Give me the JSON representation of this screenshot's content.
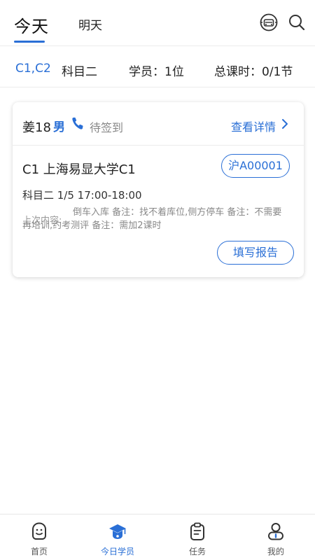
{
  "header": {
    "tabs": [
      {
        "label": "今天",
        "active": true
      },
      {
        "label": "明天",
        "active": false
      }
    ],
    "icons": [
      "car-icon",
      "search-icon"
    ]
  },
  "summary": {
    "license": "C1,C2",
    "subject": "科目二",
    "students": "学员：1位",
    "hours": "总课时：0/1节"
  },
  "card": {
    "name": "姜18",
    "gender": "男",
    "status": "待签到",
    "details": "查看详情",
    "school": "C1 上海易显大学C1",
    "plate": "沪A00001",
    "schedule": "科目二  1/5  17:00-18:00",
    "last_label": "上次内容:",
    "last_content": "倒车入库 备注：找不着库位,侧方停车 备注：不需要再培训,约考测评 备注：需加2课时",
    "report_button": "填写报告"
  },
  "nav": {
    "items": [
      {
        "label": "首页",
        "icon": "home-icon",
        "active": false
      },
      {
        "label": "今日学员",
        "icon": "graduation-cap-icon",
        "active": true
      },
      {
        "label": "任务",
        "icon": "clipboard-icon",
        "active": false
      },
      {
        "label": "我的",
        "icon": "user-icon",
        "active": false
      }
    ]
  },
  "colors": {
    "accent": "#2a6fd6",
    "text": "#222222",
    "muted": "#888888"
  }
}
